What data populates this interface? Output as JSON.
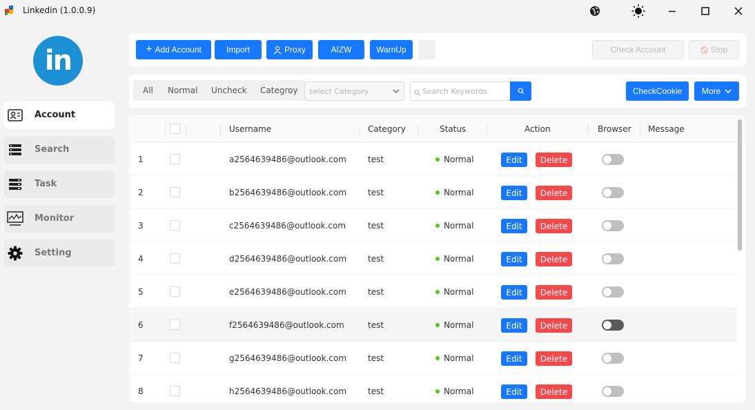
{
  "window": {
    "title": "Linkedin (1.0.0.9)",
    "controls": [
      "globe-icon",
      "theme-sun-icon",
      "minimize-icon",
      "maximize-icon",
      "close-icon"
    ]
  },
  "logo": {
    "text": "in",
    "color": "#1d8fd3"
  },
  "sidebar": {
    "items": [
      {
        "label": "Account",
        "icon": "account-card-icon",
        "active": true
      },
      {
        "label": "Search",
        "icon": "search-list-icon",
        "active": false
      },
      {
        "label": "Task",
        "icon": "task-list-icon",
        "active": false
      },
      {
        "label": "Monitor",
        "icon": "monitor-icon",
        "active": false
      },
      {
        "label": "Setting",
        "icon": "gear-icon",
        "active": false
      }
    ]
  },
  "toolbar": {
    "add_account": "Add Account",
    "import": "Import",
    "proxy": "Proxy",
    "aizw": "AIZW",
    "warnup": "WarnUp",
    "check_account": "Check Account",
    "stop": "Stop"
  },
  "filters": {
    "tabs": [
      "All",
      "Normal",
      "Uncheck",
      "Categroy"
    ],
    "category_placeholder": "select Category",
    "search_placeholder": "Search Keywords",
    "check_cookie": "CheckCookie",
    "more": "More"
  },
  "table": {
    "headers": {
      "username": "Username",
      "category": "Category",
      "status": "Status",
      "action": "Action",
      "browser": "Browser",
      "message": "Message"
    },
    "edit_label": "Edit",
    "delete_label": "Delete",
    "rows": [
      {
        "index": "1",
        "username": "a2564639486@outlook.com",
        "category": "test",
        "status": "Normal",
        "message": ""
      },
      {
        "index": "2",
        "username": "b2564639486@outlook.com",
        "category": "test",
        "status": "Normal",
        "message": ""
      },
      {
        "index": "3",
        "username": "c2564639486@outlook.com",
        "category": "test",
        "status": "Normal",
        "message": ""
      },
      {
        "index": "4",
        "username": "d2564639486@outlook.com",
        "category": "test",
        "status": "Normal",
        "message": ""
      },
      {
        "index": "5",
        "username": "e2564639486@outlook.com",
        "category": "test",
        "status": "Normal",
        "message": ""
      },
      {
        "index": "6",
        "username": "f2564639486@outlook.com",
        "category": "test",
        "status": "Normal",
        "message": ""
      },
      {
        "index": "7",
        "username": "g2564639486@outlook.com",
        "category": "test",
        "status": "Normal",
        "message": ""
      },
      {
        "index": "8",
        "username": "h2564639486@outlook.com",
        "category": "test",
        "status": "Normal",
        "message": ""
      }
    ]
  },
  "colors": {
    "primary": "#1677ff",
    "danger": "#f5484a",
    "success": "#52c41a"
  }
}
